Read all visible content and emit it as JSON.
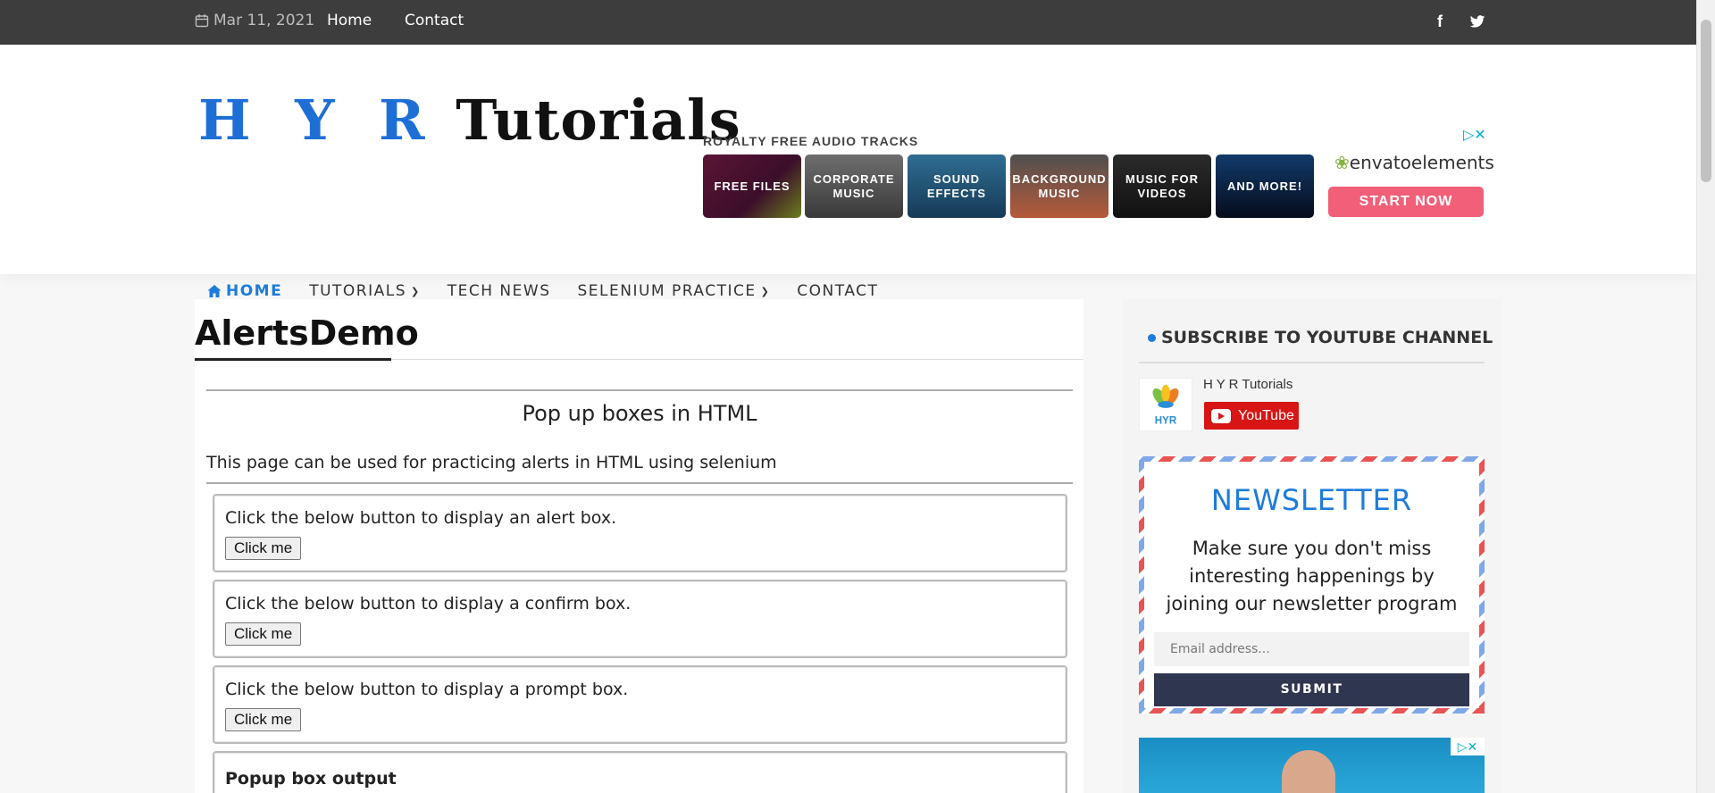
{
  "topbar": {
    "date": "Mar 11, 2021",
    "links": [
      "Home",
      "Contact"
    ],
    "social": [
      "facebook-icon",
      "twitter-icon"
    ]
  },
  "header": {
    "logo_part1": "H Y R",
    "logo_part2": "Tutorials"
  },
  "ad": {
    "title": "ROYALTY FREE AUDIO TRACKS",
    "tiles": [
      "FREE FILES",
      "CORPORATE MUSIC",
      "SOUND EFFECTS",
      "BACKGROUND MUSIC",
      "MUSIC FOR VIDEOS",
      "AND MORE!"
    ],
    "brand": "envatoelements",
    "cta": "START NOW"
  },
  "nav": {
    "items": [
      {
        "label": "HOME"
      },
      {
        "label": "TUTORIALS"
      },
      {
        "label": "TECH NEWS"
      },
      {
        "label": "SELENIUM PRACTICE"
      },
      {
        "label": "CONTACT"
      }
    ]
  },
  "main": {
    "title": "AlertsDemo",
    "heading": "Pop up boxes in HTML",
    "intro": "This page can be used for practicing alerts in HTML using selenium",
    "boxes": [
      {
        "label": "Click the below button to display an alert box.",
        "button": "Click me"
      },
      {
        "label": "Click the below button to display a confirm box.",
        "button": "Click me"
      },
      {
        "label": "Click the below button to display a prompt box.",
        "button": "Click me"
      }
    ],
    "output_label": "Popup box output"
  },
  "sidebar": {
    "widget_title": "SUBSCRIBE TO YOUTUBE CHANNEL",
    "channel_name": "H Y R Tutorials",
    "yt_label": "YouTube",
    "channel_logo_text": "HYR",
    "newsletter": {
      "title": "NEWSLETTER",
      "text": "Make sure you don't miss interesting happenings by joining our newsletter program",
      "placeholder": "Email address...",
      "submit": "SUBMIT"
    }
  },
  "colors": {
    "accent": "#1d7cdb",
    "topbar": "#3d3d3d",
    "cta": "#f15f78",
    "submit": "#2f3650",
    "youtube": "#d81515"
  }
}
